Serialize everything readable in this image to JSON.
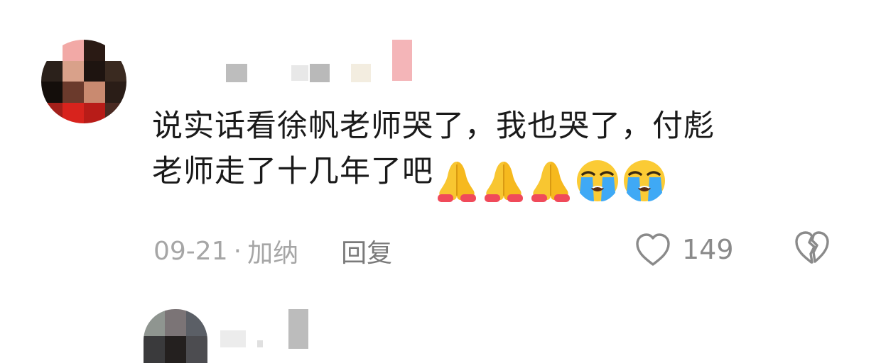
{
  "comment": {
    "text_line1": "说实话看徐帆老师哭了，我也哭了，付彪",
    "text_line2": "老师走了十几年了吧",
    "emojis": [
      "folded-hands-icon",
      "folded-hands-icon",
      "folded-hands-icon",
      "loudly-crying-face-icon",
      "loudly-crying-face-icon"
    ],
    "date": "09-21",
    "separator": "·",
    "location": "加纳",
    "reply_label": "回复",
    "like_count": "149"
  },
  "colors": {
    "text": "#1a1a1a",
    "meta": "#a6a6a6",
    "icon_outline": "#8a8a8a"
  }
}
